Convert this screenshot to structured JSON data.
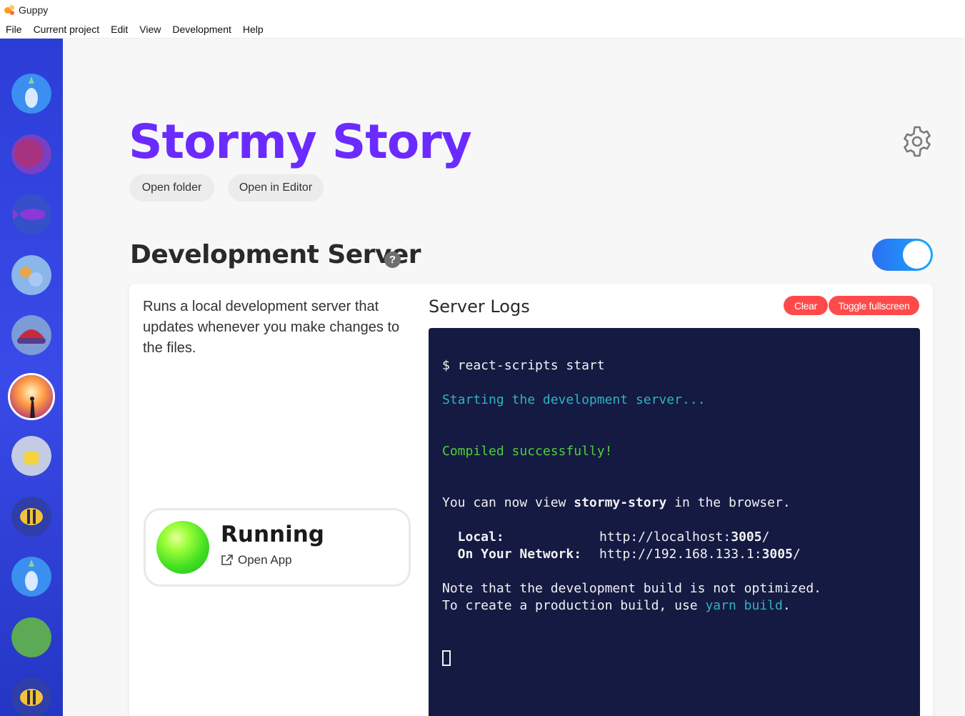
{
  "window": {
    "title": "Guppy"
  },
  "menu": [
    "File",
    "Current project",
    "Edit",
    "View",
    "Development",
    "Help"
  ],
  "sidebar": {
    "projects": [
      {
        "icon": "pineapple-avatar",
        "bg": "#3b8ff0"
      },
      {
        "icon": "purple-blob-avatar",
        "bg": "#b3306f"
      },
      {
        "icon": "fish-avatar",
        "bg": "#3550c9"
      },
      {
        "icon": "coral-avatar",
        "bg": "#8ab6ea"
      },
      {
        "icon": "hat-avatar",
        "bg": "#7c9cd8"
      },
      {
        "icon": "sunset-avatar",
        "bg": "#ff8d3a",
        "selected": true
      },
      {
        "icon": "cup-avatar",
        "bg": "#c4cbe3"
      },
      {
        "icon": "fish-avatar",
        "bg": "#2f3ea9"
      },
      {
        "icon": "pineapple-avatar",
        "bg": "#3b8ff0"
      },
      {
        "icon": "green-blob-avatar",
        "bg": "#5caa55"
      },
      {
        "icon": "fish-avatar",
        "bg": "#2f3ea9"
      }
    ]
  },
  "project": {
    "name": "Stormy Story",
    "open_folder_label": "Open folder",
    "open_editor_label": "Open in Editor"
  },
  "dev_server": {
    "title": "Development Server",
    "help_glyph": "?",
    "enabled": true,
    "description": "Runs a local development server that updates whenever you make changes to the files.",
    "status": "Running",
    "open_app_label": "Open App",
    "logs_title": "Server Logs",
    "clear_label": "Clear",
    "fullscreen_label": "Toggle fullscreen",
    "logs": {
      "command": "$ react-scripts start",
      "starting": "Starting the development server...",
      "compiled": "Compiled successfully!",
      "view_prefix": "You can now view ",
      "view_app": "stormy-story",
      "view_suffix": " in the browser.",
      "local_label": "  Local:",
      "local_url_prefix": "http://localhost:",
      "local_port": "3005",
      "local_url_suffix": "/",
      "network_label": "  On Your Network:",
      "network_url_prefix": "http://192.168.133.1:",
      "network_port": "3005",
      "network_url_suffix": "/",
      "note1": "Note that the development build is not optimized.",
      "note2_prefix": "To create a production build, use ",
      "note2_cmd": "yarn build",
      "note2_suffix": "."
    }
  },
  "colors": {
    "accent": "#6b2bff",
    "sidebar": "#3a4ae8",
    "terminal_bg": "#141a42",
    "danger": "#ff4a4a",
    "toggle": "#2c6ff0"
  }
}
